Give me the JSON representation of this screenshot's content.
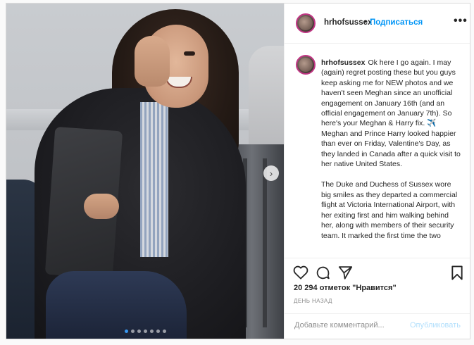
{
  "header": {
    "username": "hrhofsussex",
    "separator": "•",
    "follow_label": "Подписаться",
    "more_label": "•••"
  },
  "caption": {
    "username": "hrhofsussex",
    "paragraph1": "Ok here I go again. I may (again) regret posting these but you guys keep asking me for NEW photos and we haven't seen Meghan since an unofficial engagement on January 16th (and an official engagement on January 7th). So here's your Meghan & Harry fix. ✈️ Meghan and Prince Harry looked happier than ever on Friday, Valentine's Day, as they landed in Canada after a quick visit to her native United States.",
    "paragraph2": "The Duke and Duchess of Sussex wore big smiles as they departed a commercial flight at Victoria International Airport, with her exiting first and him walking behind her, along with members of their security team. It marked the first time the two"
  },
  "actions": {
    "like_icon": "heart-icon",
    "comment_icon": "comment-icon",
    "share_icon": "paper-plane-icon",
    "save_icon": "bookmark-icon"
  },
  "likes_text": "20 294 отметок \"Нравится\"",
  "timestamp": "День назад",
  "comment": {
    "placeholder": "Добавьте комментарий...",
    "post_label": "Опубликовать"
  },
  "carousel": {
    "next_icon": "chevron-right-icon",
    "slide_count": 7,
    "active_index": 0
  },
  "colors": {
    "accent": "#0095f6",
    "post_disabled": "#b2dffc",
    "story_ring": "#c13584"
  }
}
